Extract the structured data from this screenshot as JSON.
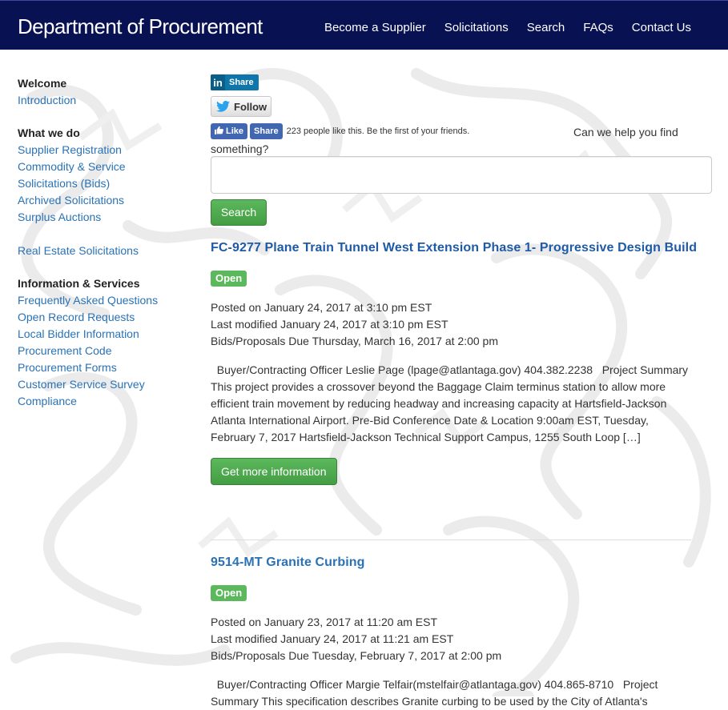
{
  "header": {
    "title": "Department of Procurement",
    "nav": [
      "Become a Supplier",
      "Solicitations",
      "Search",
      "FAQs",
      "Contact Us"
    ]
  },
  "sidebar": {
    "welcome_heading": "Welcome",
    "welcome_links": [
      "Introduction"
    ],
    "whatwedo_heading": "What we do",
    "whatwedo_links": [
      "Supplier Registration",
      "Commodity & Service",
      "Solicitations (Bids)",
      "Archived Solicitations",
      "Surplus Auctions"
    ],
    "realestate_link": "Real Estate Solicitations",
    "info_heading": "Information & Services",
    "info_links": [
      "Frequently Asked Questions",
      "Open Record Requests",
      "Local Bidder Information",
      "Procurement Code",
      "Procurement Forms",
      "Customer Service Survey",
      "Compliance"
    ]
  },
  "social": {
    "linkedin_logo": "in",
    "linkedin_label": "Share",
    "twitter_label": "Follow",
    "fb_like_label": "Like",
    "fb_share_label": "Share",
    "fb_count_text": "223 people like this. Be the first of your friends."
  },
  "search": {
    "prompt_line1": "Can we help you find",
    "prompt_line2": "something?",
    "input_value": "",
    "button_label": "Search"
  },
  "listings": [
    {
      "title": "FC-9277 Plane Train Tunnel West Extension Phase 1- Progressive Design Build",
      "status": "Open",
      "posted": "Posted on January 24, 2017 at 3:10 pm EST",
      "modified": "Last modified January 24, 2017 at 3:10 pm EST",
      "due": "Bids/Proposals Due Thursday, March 16, 2017 at 2:00 pm",
      "summary": "  Buyer/Contracting Officer Leslie Page (lpage@atlantaga.gov) 404.382.2238   Project Summary This project provides a crossover beyond the Baggage Claim terminus station to allow more efficient train movement by reducing headway and increasing capacity at Hartsfield-Jackson Atlanta International Airport. Pre-Bid Conference Date & Location 9:00am EST, Tuesday, February 7, 2017 Hartsfield-Jackson Technical Support Campus, 1255 South Loop […]",
      "button_label": "Get more information",
      "title_color": "#1f5aa6"
    },
    {
      "title": "9514-MT Granite Curbing",
      "status": "Open",
      "posted": "Posted on January 23, 2017 at 11:20 am EST",
      "modified": "Last modified January 24, 2017 at 11:21 am EST",
      "due": "Bids/Proposals Due Tuesday, February 7, 2017 at 2:00 pm",
      "summary": "  Buyer/Contracting Officer Margie Telfair(mstelfair@atlantaga.gov) 404.865-8710   Project Summary This specification describes Granite curbing to be used by the City of Atlanta's",
      "title_color": "#2a72b5"
    }
  ],
  "colors": {
    "header_bg": "#081152",
    "link": "#2a72b5",
    "button_green": "#5cb85c"
  }
}
